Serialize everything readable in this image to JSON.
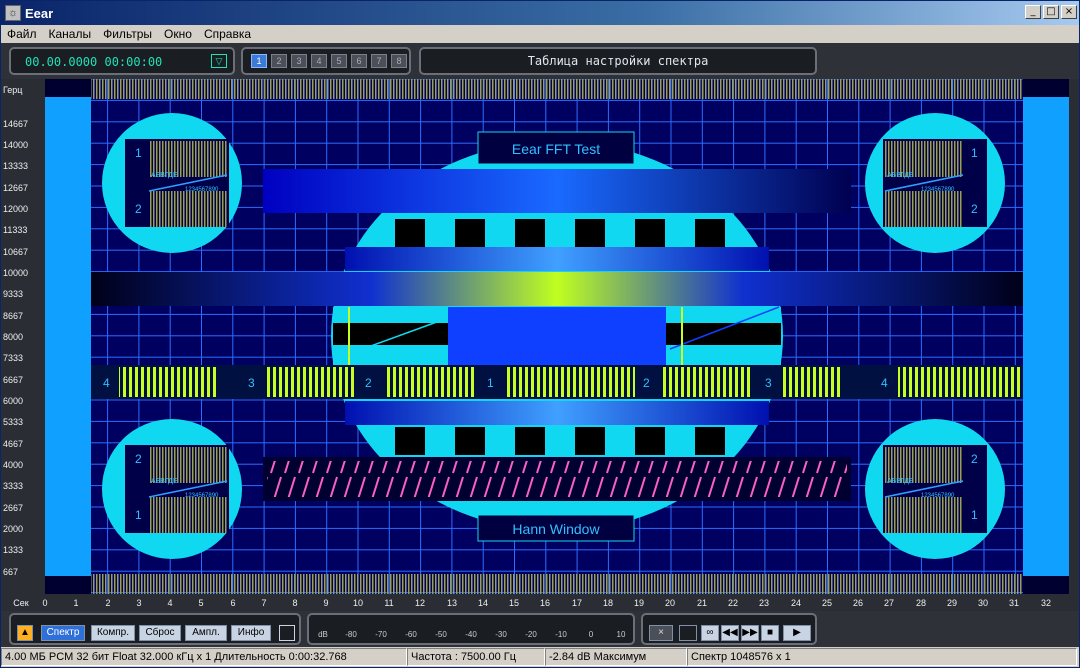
{
  "window": {
    "title": "Eear",
    "controls": [
      "_",
      "□",
      "×"
    ]
  },
  "menu": [
    "Файл",
    "Каналы",
    "Фильтры",
    "Окно",
    "Справка"
  ],
  "toolbar": {
    "time": "00.00.0000 00:00:00",
    "pages": [
      "1",
      "2",
      "3",
      "4",
      "5",
      "6",
      "7",
      "8"
    ],
    "doc_title": "Таблица настройки спектра"
  },
  "y_axis": {
    "unit": "Герц",
    "ticks": [
      "14667",
      "14000",
      "13333",
      "12667",
      "12000",
      "11333",
      "10667",
      "10000",
      "9333",
      "8667",
      "8000",
      "7333",
      "6667",
      "6000",
      "5333",
      "4667",
      "4000",
      "3333",
      "2667",
      "2000",
      "1333",
      "667"
    ]
  },
  "x_axis": {
    "unit": "Сек",
    "ticks": [
      "0",
      "1",
      "2",
      "3",
      "4",
      "5",
      "6",
      "7",
      "8",
      "9",
      "10",
      "11",
      "12",
      "13",
      "14",
      "15",
      "16",
      "17",
      "18",
      "19",
      "20",
      "21",
      "22",
      "23",
      "24",
      "25",
      "26",
      "27",
      "28",
      "29",
      "30",
      "31",
      "32"
    ]
  },
  "test_pattern": {
    "top_label": "Eear FFT Test",
    "bottom_label": "Hann Window",
    "corner_text": "АБВГДЕ",
    "corner_digits": "1234567890",
    "corner_top_numbers": [
      "1",
      "2"
    ],
    "corner_bottom_numbers": [
      "2",
      "1"
    ],
    "bar_numbers": [
      "4",
      "3",
      "2",
      "1",
      "2",
      "3",
      "4"
    ]
  },
  "controls": {
    "buttons": [
      "Спектр",
      "Компр.",
      "Сброс",
      "Ампл.",
      "Инфо"
    ],
    "scale_label": "dB",
    "scale": [
      "-80",
      "-70",
      "-60",
      "-50",
      "-40",
      "-30",
      "-20",
      "-10",
      "0",
      "10"
    ],
    "transport": [
      "×",
      "",
      "∞",
      "◀◀",
      "▶▶",
      "■",
      "▶"
    ]
  },
  "status": [
    "4.00 МБ PCM 32 бит Float 32.000 кГц x 1  Длительность 0:00:32.768",
    "Частота : 7500.00 Гц",
    "-2.84 dB Максимум",
    "Спектр 1048576 x 1"
  ]
}
